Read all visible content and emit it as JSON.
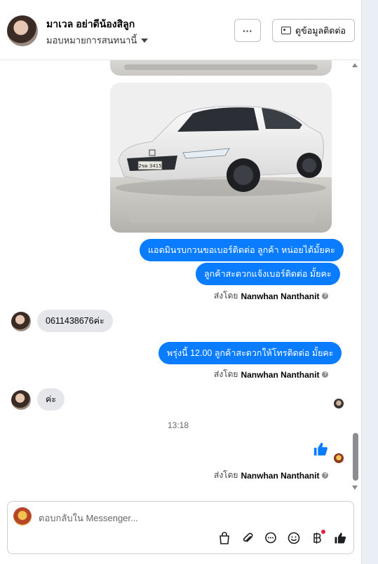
{
  "header": {
    "name": "มาเวล อย่าดีน้องสิลูก",
    "assign_label": "มอบหมายการสนทนานี้",
    "more_label": "···",
    "contact_label": "ดูข้อมูลติดต่อ"
  },
  "messages": {
    "out1": "แอดมินรบกวนขอเบอร์ติดต่อ ลูกค้า หน่อยได้มั้ยคะ",
    "out2": "ลูกค้าสะดวกแจ้งเบอร์ติดต่อ มั้ยคะ",
    "sent_by_prefix": "ส่งโดย",
    "sender_name": "Nanwhan Nanthanit",
    "in1": "0611438676ค่ะ",
    "out3": "พรุ่งนี้ 12.00 ลูกค้าสะดวกให้โทรติดต่อ มั้ยคะ",
    "in2": "ค่ะ",
    "timestamp": "13:18",
    "plate_text": "2ขผ 3415"
  },
  "composer": {
    "placeholder": "ตอบกลับใน Messenger..."
  },
  "colors": {
    "accent": "#0a7cff",
    "incoming_bubble": "#e4e6eb"
  }
}
